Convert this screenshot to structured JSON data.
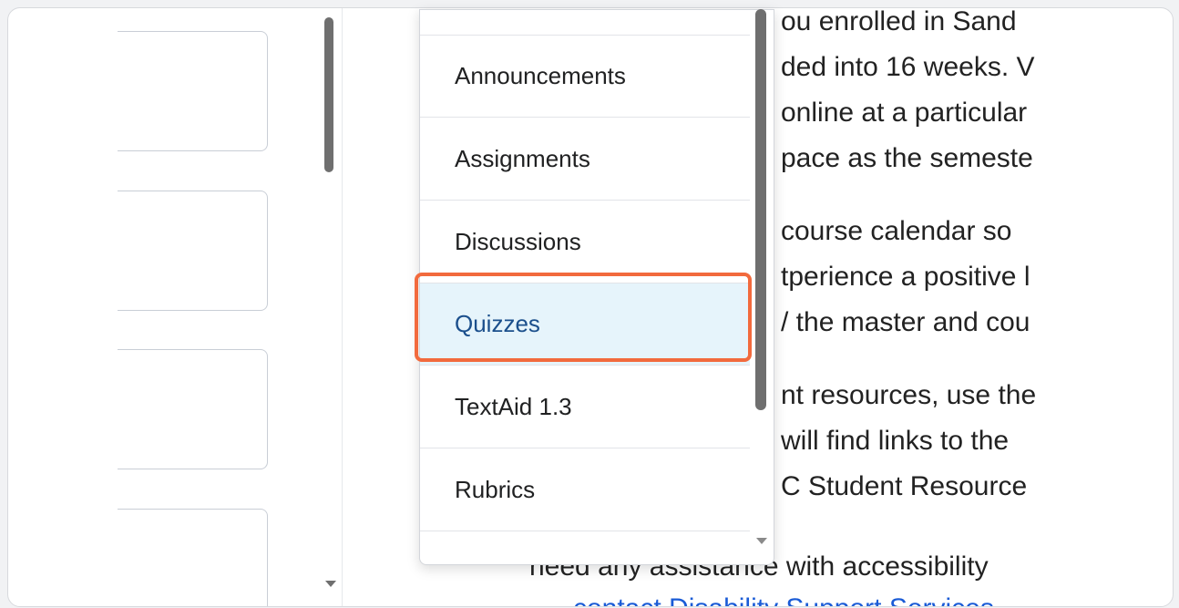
{
  "background_text": {
    "lines": [
      "ou enrolled in Sand",
      "ded into 16 weeks. V",
      "online at a particular",
      " pace as the semeste",
      "",
      " course calendar so",
      "tperience a positive l",
      "/ the master and cou",
      "",
      "nt resources, use the",
      " will find links to the",
      "C Student Resource"
    ],
    "bottom_line_1": "need any assistance with accessibility",
    "bottom_line_2": "contact Disability Support Services"
  },
  "menu": {
    "items": [
      {
        "label": ""
      },
      {
        "label": "Announcements"
      },
      {
        "label": "Assignments"
      },
      {
        "label": "Discussions"
      },
      {
        "label": "Quizzes"
      },
      {
        "label": "TextAid 1.3"
      },
      {
        "label": "Rubrics"
      }
    ],
    "selected_index": 4
  },
  "colors": {
    "highlight": "#f26a3d",
    "selected_bg": "#e6f4fb",
    "selected_text": "#1b4f8c",
    "link": "#1a5bd6"
  }
}
